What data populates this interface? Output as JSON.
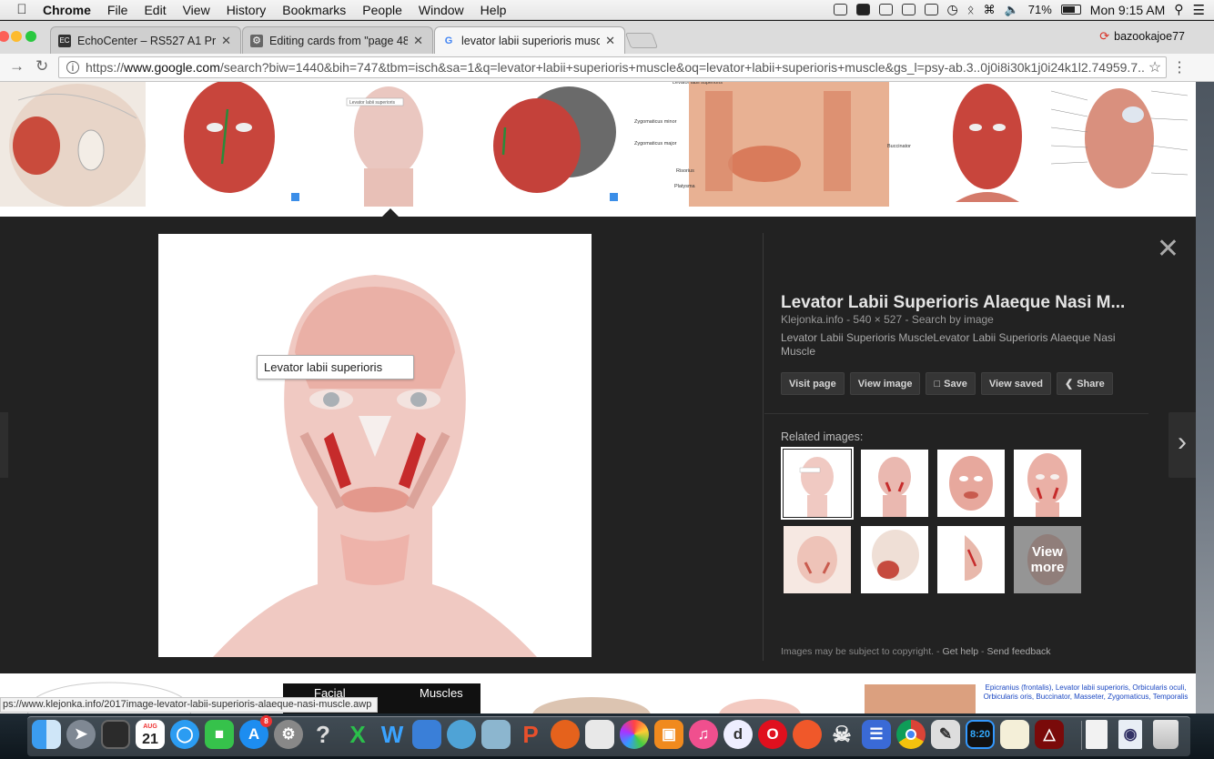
{
  "menubar": {
    "app": "Chrome",
    "items": [
      "File",
      "Edit",
      "View",
      "History",
      "Bookmarks",
      "People",
      "Window",
      "Help"
    ],
    "battery": "71%",
    "clock": "Mon 9:15 AM"
  },
  "tabs": [
    {
      "title": "EchoCenter – RS527 A1 Pre-D",
      "favicon": "echocenter-icon"
    },
    {
      "title": "Editing cards from \"page 48-5",
      "favicon": "cards-icon"
    },
    {
      "title": "levator labii superioris muscle",
      "favicon": "google-icon"
    }
  ],
  "profile": {
    "name": "bazookajoe77"
  },
  "omnibox": {
    "url_prefix": "https://",
    "url_host": "www.google.com",
    "url_rest": "/search?biw=1440&bih=747&tbm=isch&sa=1&q=levator+labii+superioris+muscle&oq=levator+labii+superioris+muscle&gs_l=psy-ab.3..0j0i8i30k1j0i24k1l2.74959.7..."
  },
  "strip_diagram": {
    "labels": [
      "Levator labii superioris",
      "Zygomaticus minor",
      "Zygomaticus major",
      "Risorius",
      "Platysma",
      "Buccinator"
    ]
  },
  "preview": {
    "label": "Levator labii superioris",
    "title": "Levator Labii Superioris Alaeque Nasi M...",
    "site": "Klejonka.info",
    "dimensions": "540 × 527",
    "search_by_image": "Search by image",
    "description": "Levator Labii Superioris MuscleLevator Labii Superioris Alaeque Nasi Muscle"
  },
  "actions": [
    {
      "label": "Visit page",
      "icon": ""
    },
    {
      "label": "View image",
      "icon": ""
    },
    {
      "label": "Save",
      "icon": "bookmark-icon"
    },
    {
      "label": "View saved",
      "icon": ""
    },
    {
      "label": "Share",
      "icon": "share-icon"
    }
  ],
  "related": {
    "label": "Related images:",
    "view_more": "View more"
  },
  "footer": {
    "copyright": "Images may be subject to copyright.",
    "help": "Get help",
    "feedback": "Send feedback"
  },
  "bottom_strip": {
    "banner_left": "Facial",
    "banner_right": "Muscles",
    "blue_text": "Epicranius (frontalis), Levator labii superioris, Orbicularis oculi, Orbicularis oris, Buccinator, Masseter, Zygomaticus, Temporalis"
  },
  "status_url": "ps://www.klejonka.info/2017image-levator-labii-superioris-alaeque-nasi-muscle.awp",
  "dock": {
    "calendar_month": "AUG",
    "calendar_day": "21",
    "appstore_badge": "8",
    "clock_text": "8:20",
    "items": [
      "finder",
      "launchpad",
      "dashboard",
      "calendar",
      "messages",
      "facetime",
      "app-store",
      "system-preferences",
      "help",
      "excel",
      "word",
      "teams",
      "network",
      "preview",
      "powerpoint",
      "firefox",
      "mail",
      "photos",
      "ibooks",
      "itunes",
      "disk",
      "opera",
      "firefox-dev",
      "skull",
      "notes",
      "chrome",
      "brush",
      "clock",
      "textedit",
      "acrobat",
      "file",
      "preview-doc",
      "trash"
    ]
  },
  "colors": {
    "panel_bg": "#222222",
    "accent_red": "#d93025",
    "link_blue": "#1a47c2"
  }
}
